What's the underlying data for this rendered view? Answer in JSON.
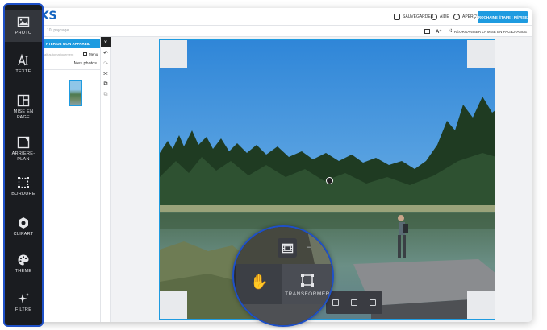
{
  "app": {
    "logo": "KS",
    "search_placeholder": "10, paysage"
  },
  "topbar": {
    "save_label": "SAUVEGARDER",
    "help_label": "AIDE",
    "preview_label": "APERÇU",
    "next_label": "PROCHAINE ÉTAPE : RÉVISEZ"
  },
  "subbar": {
    "reorganize_label": "RÉORGANISER LA MISE EN PAGE",
    "change_label": "CHANGE"
  },
  "panel": {
    "import_label": "PTER DE MON APPAREIL",
    "search_placeholder": "alt automatiquement",
    "menu_label": "Menu",
    "my_photos_label": "Mes photos"
  },
  "sidebar": {
    "items": [
      {
        "label": "PHOTO",
        "icon": "photo-icon",
        "active": true
      },
      {
        "label": "TEXTE",
        "icon": "text-icon",
        "active": false
      },
      {
        "label": "MISE EN\nPAGE",
        "icon": "layout-icon",
        "active": false
      },
      {
        "label": "ARRIÈRE-\nPLAN",
        "icon": "background-icon",
        "active": false
      },
      {
        "label": "BORDURE",
        "icon": "border-icon",
        "active": false
      },
      {
        "label": "CLIPART",
        "icon": "clipart-icon",
        "active": false
      },
      {
        "label": "THÈME",
        "icon": "palette-icon",
        "active": false
      },
      {
        "label": "FILTRE",
        "icon": "sparkle-icon",
        "active": false
      }
    ]
  },
  "magnifier": {
    "transform_label": "TRANSFORMER"
  },
  "colors": {
    "accent": "#1e9be0",
    "sidebar_bg": "#1a1c20",
    "highlight_border": "#1e50c8"
  }
}
